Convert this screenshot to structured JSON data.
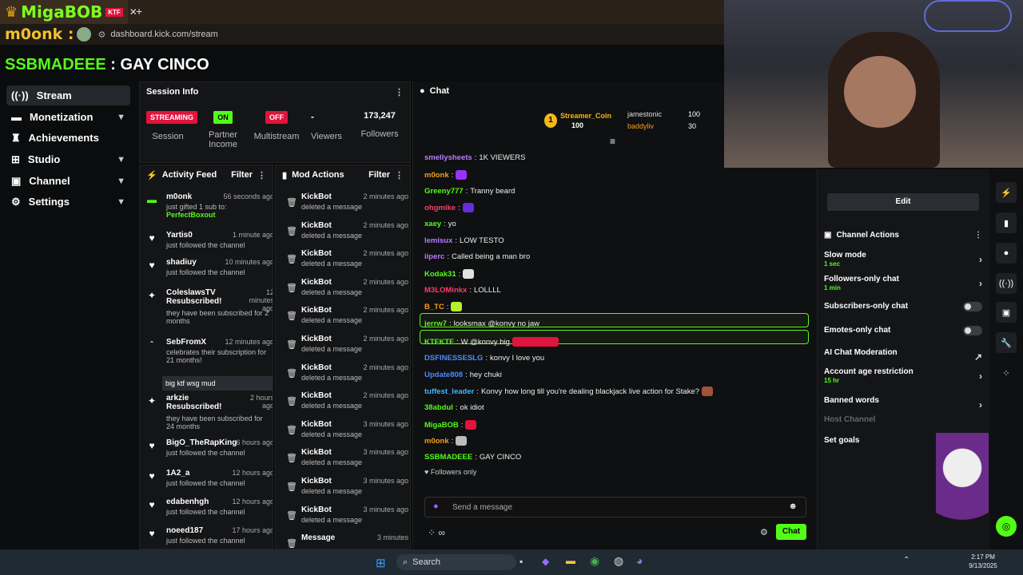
{
  "browser": {
    "tab_logo": "MigaBOB",
    "tab_close": "✕",
    "new_tab": "+",
    "overlay_name": "m0onk :",
    "url": "dashboard.kick.com/stream"
  },
  "page": {
    "streamer": "SSBMADEEE",
    "title_sep": " : ",
    "title": "GAY CINCO"
  },
  "sidebar": {
    "items": [
      {
        "label": "Stream"
      },
      {
        "label": "Monetization"
      },
      {
        "label": "Achievements"
      },
      {
        "label": "Studio"
      },
      {
        "label": "Channel"
      },
      {
        "label": "Settings"
      }
    ]
  },
  "session": {
    "title": "Session Info",
    "status_badge": "STREAMING",
    "status_label": "Session",
    "partner_badge": "ON",
    "partner_label": "Partner Income",
    "multistream_badge": "OFF",
    "multistream_label": "Multistream",
    "viewers_value": "-",
    "viewers_label": "Viewers",
    "followers_value": "173,247",
    "followers_label": "Followers"
  },
  "activity": {
    "title": "Activity Feed",
    "filter": "Filter",
    "rows": [
      {
        "name": "m0onk",
        "time": "56 seconds ago",
        "sub": "just gifted 1 sub to:",
        "extra": "PerfectBoxout"
      },
      {
        "name": "Yartis0",
        "time": "1 minute ago",
        "sub": "just followed the channel"
      },
      {
        "name": "shadiuy",
        "time": "10 minutes ago",
        "sub": "just followed the channel"
      },
      {
        "name": "ColeslawsTV Resubscribed!",
        "time": "12 minutes ago",
        "sub": "they have been subscribed for 2 months"
      },
      {
        "name": "SebFromX",
        "time": "12 minutes ago",
        "sub": "celebrates their subscription for 21 months!",
        "extra": "big ktf wsg mud"
      },
      {
        "name": "arkzie Resubscribed!",
        "time": "2 hours ago",
        "sub": "they have been subscribed for 24 months"
      },
      {
        "name": "BigO_TheRapKing",
        "time": "6 hours ago",
        "sub": "just followed the channel"
      },
      {
        "name": "1A2_a",
        "time": "12 hours ago",
        "sub": "just followed the channel"
      },
      {
        "name": "edabenhgh",
        "time": "12 hours ago",
        "sub": "just followed the channel"
      },
      {
        "name": "noeed187",
        "time": "17 hours ago",
        "sub": "just followed the channel"
      }
    ]
  },
  "mod": {
    "title": "Mod Actions",
    "filter": "Filter",
    "rows": [
      {
        "name": "KickBot",
        "time": "2 minutes ago",
        "sub": "deleted a message"
      },
      {
        "name": "KickBot",
        "time": "2 minutes ago",
        "sub": "deleted a message"
      },
      {
        "name": "KickBot",
        "time": "2 minutes ago",
        "sub": "deleted a message"
      },
      {
        "name": "KickBot",
        "time": "2 minutes ago",
        "sub": "deleted a message"
      },
      {
        "name": "KickBot",
        "time": "2 minutes ago",
        "sub": "deleted a message"
      },
      {
        "name": "KickBot",
        "time": "2 minutes ago",
        "sub": "deleted a message"
      },
      {
        "name": "KickBot",
        "time": "2 minutes ago",
        "sub": "deleted a message"
      },
      {
        "name": "KickBot",
        "time": "2 minutes ago",
        "sub": "deleted a message"
      },
      {
        "name": "KickBot",
        "time": "3 minutes ago",
        "sub": "deleted a message"
      },
      {
        "name": "KickBot",
        "time": "3 minutes ago",
        "sub": "deleted a message"
      },
      {
        "name": "KickBot",
        "time": "3 minutes ago",
        "sub": "deleted a message"
      },
      {
        "name": "KickBot",
        "time": "3 minutes ago",
        "sub": "deleted a message"
      },
      {
        "name": "Message",
        "time": "3 minutes",
        "sub": ""
      }
    ]
  },
  "chat": {
    "title": "Chat",
    "top1_name": "Streamer_Coin",
    "top1_value": "100",
    "top2_name": "jamestonic",
    "top2_value": "100",
    "top3_name": "baddyliv",
    "top3_value": "30",
    "messages": [
      {
        "user": "smellysheets",
        "color": "#b67cff",
        "text": "1K VIEWERS"
      },
      {
        "user": "m0onk",
        "color": "#f59f1b",
        "text": ""
      },
      {
        "user": "Greeny777",
        "color": "#53fc18",
        "text": "Tranny beard"
      },
      {
        "user": "ohgmike",
        "color": "#ff3b6b",
        "text": ""
      },
      {
        "user": "xaey",
        "color": "#53fc18",
        "text": "yo"
      },
      {
        "user": "lemisux",
        "color": "#b67cff",
        "text": "LOW TESTO"
      },
      {
        "user": "iiperc",
        "color": "#b67cff",
        "text": "Called being a man bro"
      },
      {
        "user": "Kodak31",
        "color": "#53fc18",
        "text": ""
      },
      {
        "user": "M3LOMinkx",
        "color": "#ff3b6b",
        "text": "LOLLLL"
      },
      {
        "user": "B_TC",
        "color": "#f59f1b",
        "text": ""
      },
      {
        "user": "jerrw7",
        "color": "#53fc18",
        "text": "looksmax @konvy no jaw"
      },
      {
        "user": "KTFKTF",
        "color": "#53fc18",
        "text": "W @konvy big"
      },
      {
        "user": "DSFINESSESLG",
        "color": "#4a8cff",
        "text": "konvy I love you"
      },
      {
        "user": "Update808",
        "color": "#4a8cff",
        "text": "hey chuki"
      },
      {
        "user": "tuffest_leader",
        "color": "#3fb8ff",
        "text": "how long till you're dealing blackjack live action for Stake?"
      },
      {
        "user": "38abdul",
        "color": "#53fc18",
        "text": "ok idiot"
      },
      {
        "user": "MigaBOB",
        "color": "#53fc18",
        "text": ""
      },
      {
        "user": "m0onk",
        "color": "#f59f1b",
        "text": ""
      },
      {
        "user": "SSBMADEEE",
        "color": "#53fc18",
        "text": "GAY CINCO"
      }
    ],
    "konvy_mention": "Konvy",
    "followers_only": "Followers only",
    "placeholder": "Send a message",
    "send": "Chat"
  },
  "channel": {
    "edit": "Edit",
    "actions_title": "Channel Actions",
    "slow_mode": "Slow mode",
    "slow_mode_val": "1 sec",
    "followers_only": "Followers-only chat",
    "followers_only_val": "1 min",
    "subscribers_only": "Subscribers-only chat",
    "emotes_only": "Emotes-only chat",
    "ai_mod": "AI Chat Moderation",
    "age_restrict": "Account age restriction",
    "age_restrict_val": "15 hr",
    "banned_words": "Banned words",
    "host": "Host Channel",
    "goals": "Set goals"
  },
  "taskbar": {
    "search": "Search",
    "time": "2:17 PM",
    "date": "9/13/2025"
  },
  "colors": {
    "accent": "#53fc18",
    "danger": "#e0143c",
    "bg": "#0b0c0d"
  }
}
